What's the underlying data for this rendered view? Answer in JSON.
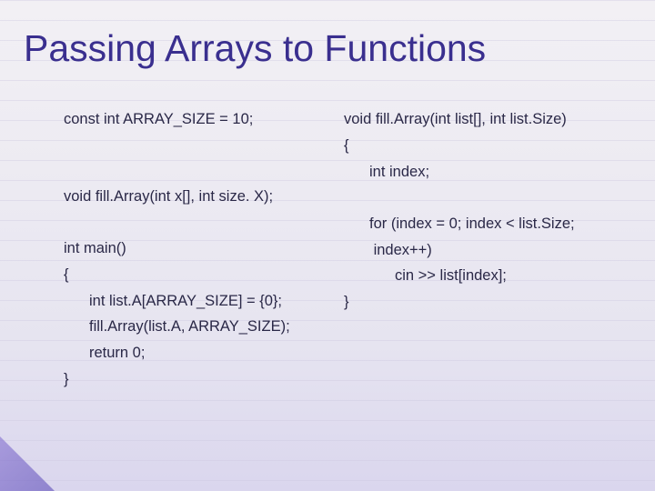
{
  "title": "Passing Arrays to Functions",
  "left": {
    "l1": "const int ARRAY_SIZE = 10;",
    "l2": "void fill.Array(int x[], int size. X);",
    "l3": "int main()",
    "l4": "{",
    "l5": "int list.A[ARRAY_SIZE] = {0};",
    "l6": "fill.Array(list.A, ARRAY_SIZE);",
    "l7": "return 0;",
    "l8": "}"
  },
  "right": {
    "r1": "void fill.Array(int list[], int list.Size)",
    "r2": "{",
    "r3": "int index;",
    "r4": "for (index = 0; index < list.Size;",
    "r5": " index++)",
    "r6": "cin >> list[index];",
    "r7": "}"
  }
}
